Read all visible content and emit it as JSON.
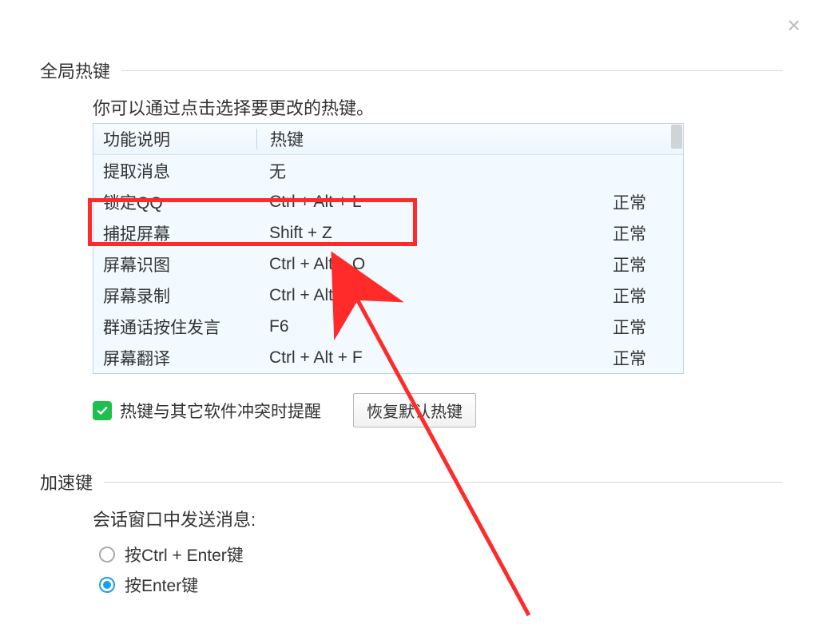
{
  "close_glyph": "×",
  "section1": {
    "title": "全局热键",
    "hint": "你可以通过点击选择要更改的热键。",
    "columns": {
      "fn": "功能说明",
      "key": "热键"
    },
    "rows": [
      {
        "fn": "提取消息",
        "key": "无",
        "status": ""
      },
      {
        "fn": "锁定QQ",
        "key": "Ctrl + Alt + L",
        "status": "正常"
      },
      {
        "fn": "捕捉屏幕",
        "key": "Shift + Z",
        "status": "正常"
      },
      {
        "fn": "屏幕识图",
        "key": "Ctrl + Alt + O",
        "status": "正常"
      },
      {
        "fn": "屏幕录制",
        "key": "Ctrl + Alt + S",
        "status": "正常"
      },
      {
        "fn": "群通话按住发言",
        "key": "F6",
        "status": "正常"
      },
      {
        "fn": "屏幕翻译",
        "key": "Ctrl + Alt + F",
        "status": "正常"
      }
    ],
    "checkbox_label": "热键与其它软件冲突时提醒",
    "restore_button": "恢复默认热键"
  },
  "section2": {
    "title": "加速键",
    "send_label": "会话窗口中发送消息:",
    "option_ctrl_enter": "按Ctrl + Enter键",
    "option_enter": "按Enter键",
    "selected": "enter"
  }
}
